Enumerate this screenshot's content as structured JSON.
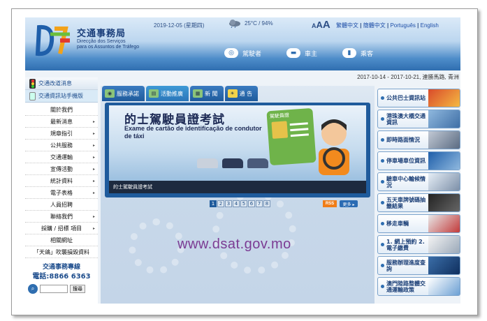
{
  "header": {
    "org_name_zh": "交通事務局",
    "org_name_pt_line1": "Direcção dos Serviços",
    "org_name_pt_line2": "para os Assuntos de Tráfego",
    "date": "2019-12-05 (星期四)",
    "weather": "25°C / 94%",
    "font_size_label": "A",
    "font_size_large": "A",
    "langs": [
      "繁體中文",
      "簡體中文",
      "Português",
      "English"
    ],
    "lang_sep": "|",
    "user_links": [
      {
        "label": "駕駛者",
        "icon": "steering-wheel-icon"
      },
      {
        "label": "車主",
        "icon": "car-icon"
      },
      {
        "label": "乘客",
        "icon": "bus-icon"
      }
    ]
  },
  "ticker": "2017-10-14 - 2017-10-21, 連勝馬路, 青洲",
  "sidebar": {
    "top_link": "交通改道消息",
    "mobile_link": "交通資訊站手機版",
    "menu": [
      {
        "label": "關於我們",
        "arrow": false
      },
      {
        "label": "最新消息",
        "arrow": true
      },
      {
        "label": "規章指引",
        "arrow": true
      },
      {
        "label": "公共服務",
        "arrow": true
      },
      {
        "label": "交通運輸",
        "arrow": true
      },
      {
        "label": "宣傳活動",
        "arrow": true
      },
      {
        "label": "統計資料",
        "arrow": true
      },
      {
        "label": "電子表格",
        "arrow": true
      },
      {
        "label": "人員招聘",
        "arrow": false
      },
      {
        "label": "聯絡我們",
        "arrow": true
      },
      {
        "label": "採購 / 招標 項目",
        "arrow": true
      },
      {
        "label": "相關網址",
        "arrow": false
      },
      {
        "label": "「天鴿」吹襲損毀資料",
        "arrow": false
      }
    ],
    "hotline_label": "交通事務專線",
    "hotline_number": "電話:8866 6363",
    "search_button": "搜尋"
  },
  "tabs": [
    {
      "label": "服務承諾",
      "active": false
    },
    {
      "label": "活動推廣",
      "active": true
    },
    {
      "label": "新 聞",
      "active": false
    },
    {
      "label": "通 告",
      "active": false
    }
  ],
  "banner": {
    "title_zh": "的士駕駛員證考試",
    "title_pt": "Exame de cartão de identificação de condutor de táxi",
    "card_label": "駕駛員證",
    "caption": "的士駕駛員證考試"
  },
  "pager": {
    "pages": [
      "1",
      "2",
      "3",
      "4",
      "5",
      "6",
      "7",
      "8"
    ],
    "current": "1",
    "rss": "RSS",
    "more": "更多 ▸"
  },
  "watermark": "www.dsat.gov.mo",
  "right_links": [
    {
      "label": "公共巴士資訊站"
    },
    {
      "label": "港珠澳大橋交通資訊"
    },
    {
      "label": "即時路面情況"
    },
    {
      "label": "停車場車位資訊"
    },
    {
      "label": "驗車中心輪候情況"
    },
    {
      "label": "五天車牌號碼抽籤結果"
    },
    {
      "label": "移走車輛"
    },
    {
      "label": "1. 網上預約 2. 電子繳費"
    },
    {
      "label": "服務辦理進度查詢"
    },
    {
      "label": "澳門陸路整體交通運輸政策"
    }
  ]
}
